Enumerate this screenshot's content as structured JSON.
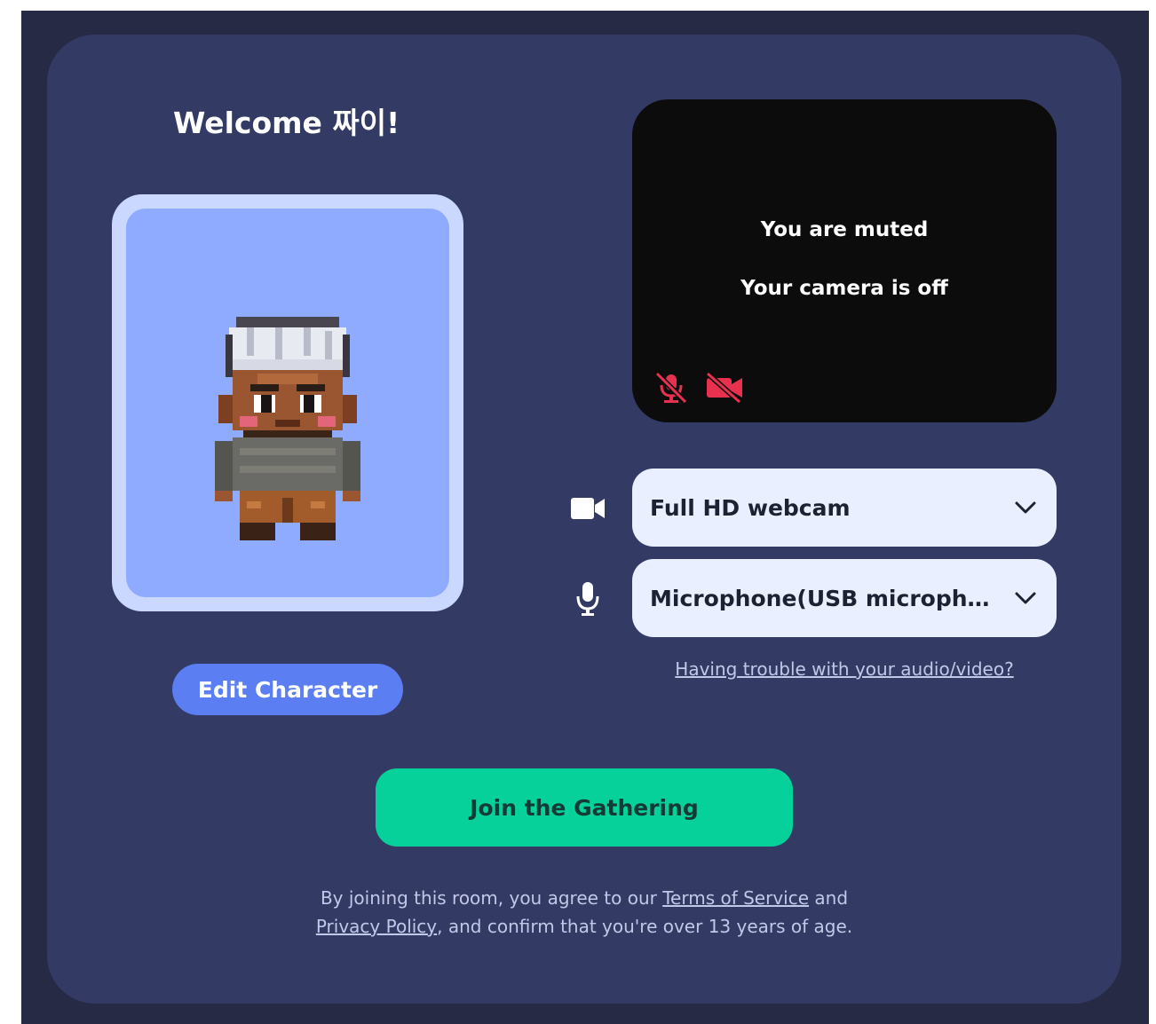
{
  "welcome": {
    "title": "Welcome 짜이!"
  },
  "character": {
    "edit_label": "Edit Character"
  },
  "preview": {
    "muted_text": "You are muted",
    "camera_text": "Your camera is off"
  },
  "devices": {
    "camera": {
      "value": "Full HD webcam",
      "icon": "video-camera-icon"
    },
    "microphone": {
      "value": "Microphone(USB micropho...",
      "icon": "microphone-icon"
    }
  },
  "trouble_link": "Having trouble with your audio/video?",
  "join": {
    "label": "Join the Gathering"
  },
  "legal": {
    "prefix": "By joining this room, you agree to our",
    "tos": "Terms of Service",
    "and": "and",
    "privacy": "Privacy Policy",
    "suffix": ", and confirm that you're over 13 years of age."
  },
  "colors": {
    "card_bg": "#333a64",
    "join_button": "#06d19b",
    "edit_button": "#5b7ff2",
    "avatar_bg": "#8fabff",
    "muted_icon": "#e8314f"
  }
}
